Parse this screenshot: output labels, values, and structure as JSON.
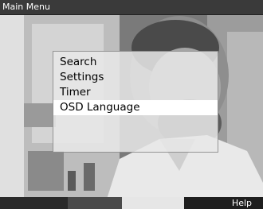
{
  "title": "Main Menu",
  "menu": {
    "items": [
      {
        "label": "Search"
      },
      {
        "label": "Settings"
      },
      {
        "label": "Timer"
      },
      {
        "label": "OSD Language"
      }
    ],
    "selected_index": 3
  },
  "bottom_bar": {
    "help_label": "Help"
  },
  "colors": {
    "title_bar": "#3a3a3a",
    "menu_background": "#e8e8e8",
    "selected_row": "#ffffff",
    "text": "#000000"
  }
}
